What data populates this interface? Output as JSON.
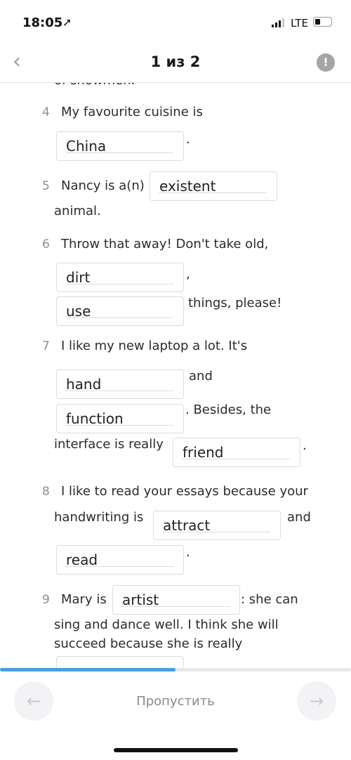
{
  "status_bar": {
    "time": "18:05",
    "network": "LTE",
    "battery_level": 0.35
  },
  "header": {
    "title": "1 из 2"
  },
  "content": {
    "prev_tail": "of snowmen.",
    "q4": {
      "num": "4",
      "text": "My favourite cuisine is",
      "answer": "China",
      "after": "."
    },
    "q5": {
      "num": "5",
      "text": "Nancy is a(n)",
      "answer": "existent",
      "after": "animal."
    },
    "q6": {
      "num": "6",
      "text": "Throw that away! Don't take old,",
      "answer1": "dirt",
      "sep": ",",
      "answer2": "use",
      "after": "things, please!"
    },
    "q7": {
      "num": "7",
      "text": "I like my new laptop a lot. It's",
      "answer1": "hand",
      "sep1": "and",
      "answer2": "function",
      "sep2": ". Besides, the",
      "text2": "interface is really",
      "answer3": "friend",
      "after": "."
    },
    "q8": {
      "num": "8",
      "text": "I like to read your essays because your",
      "text2": "handwriting is",
      "answer1": "attract",
      "sep": "and",
      "answer2": "read",
      "after": "."
    },
    "q9": {
      "num": "9",
      "text": "Mary is",
      "answer1": "artist",
      "after1": ": she can",
      "line2": "sing and dance well. I think she will",
      "line3": "succeed because she is really",
      "answer2": ""
    }
  },
  "progress": {
    "percent": 50,
    "color": "#4a9ee3"
  },
  "footer": {
    "skip": "Пропустить",
    "prev_icon": "arrow-left",
    "next_icon": "arrow-right"
  }
}
